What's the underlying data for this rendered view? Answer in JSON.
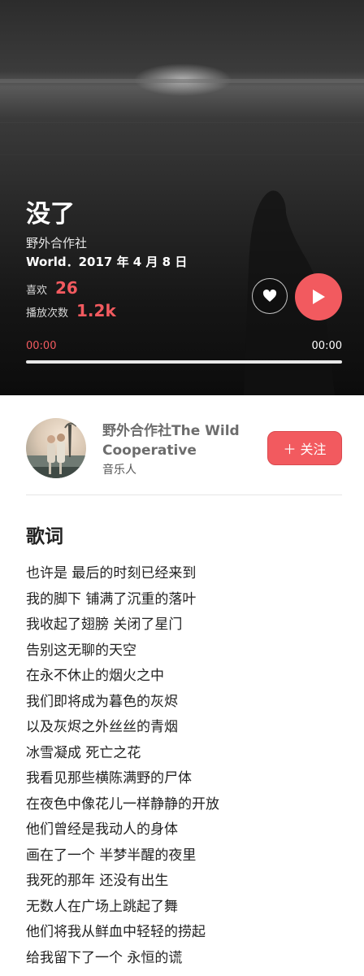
{
  "song": {
    "title": "没了",
    "artist": "野外合作社",
    "release": "World．2017 年 4 月 8 日",
    "likes_label": "喜欢",
    "likes_value": "26",
    "plays_label": "播放次数",
    "plays_value": "1.2k"
  },
  "player": {
    "current_time": "00:00",
    "total_time": "00:00",
    "progress": 0,
    "play_icon": "play-icon",
    "like_icon": "heart-icon"
  },
  "artist_card": {
    "name": "野外合作社The Wild Cooperative",
    "role": "音乐人",
    "follow_label": "＋ 关注"
  },
  "lyrics": {
    "heading": "歌词",
    "lines": [
      "也许是 最后的时刻已经来到",
      "我的脚下 铺满了沉重的落叶",
      "我收起了翅膀 关闭了星门",
      "告别这无聊的天空",
      "在永不休止的烟火之中",
      "我们即将成为暮色的灰烬",
      "以及灰烬之外丝丝的青烟",
      "冰雪凝成 死亡之花",
      "我看见那些横陈满野的尸体",
      "在夜色中像花儿一样静静的开放",
      "他们曾经是我动人的身体",
      "画在了一个 半梦半醒的夜里",
      "我死的那年 还没有出生",
      "无数人在广场上跳起了舞",
      "他们将我从鲜血中轻轻的捞起",
      "给我留下了一个 永恒的谎"
    ]
  },
  "colors": {
    "accent": "#f25a5f",
    "hero_bg": "#1e1e1e"
  }
}
